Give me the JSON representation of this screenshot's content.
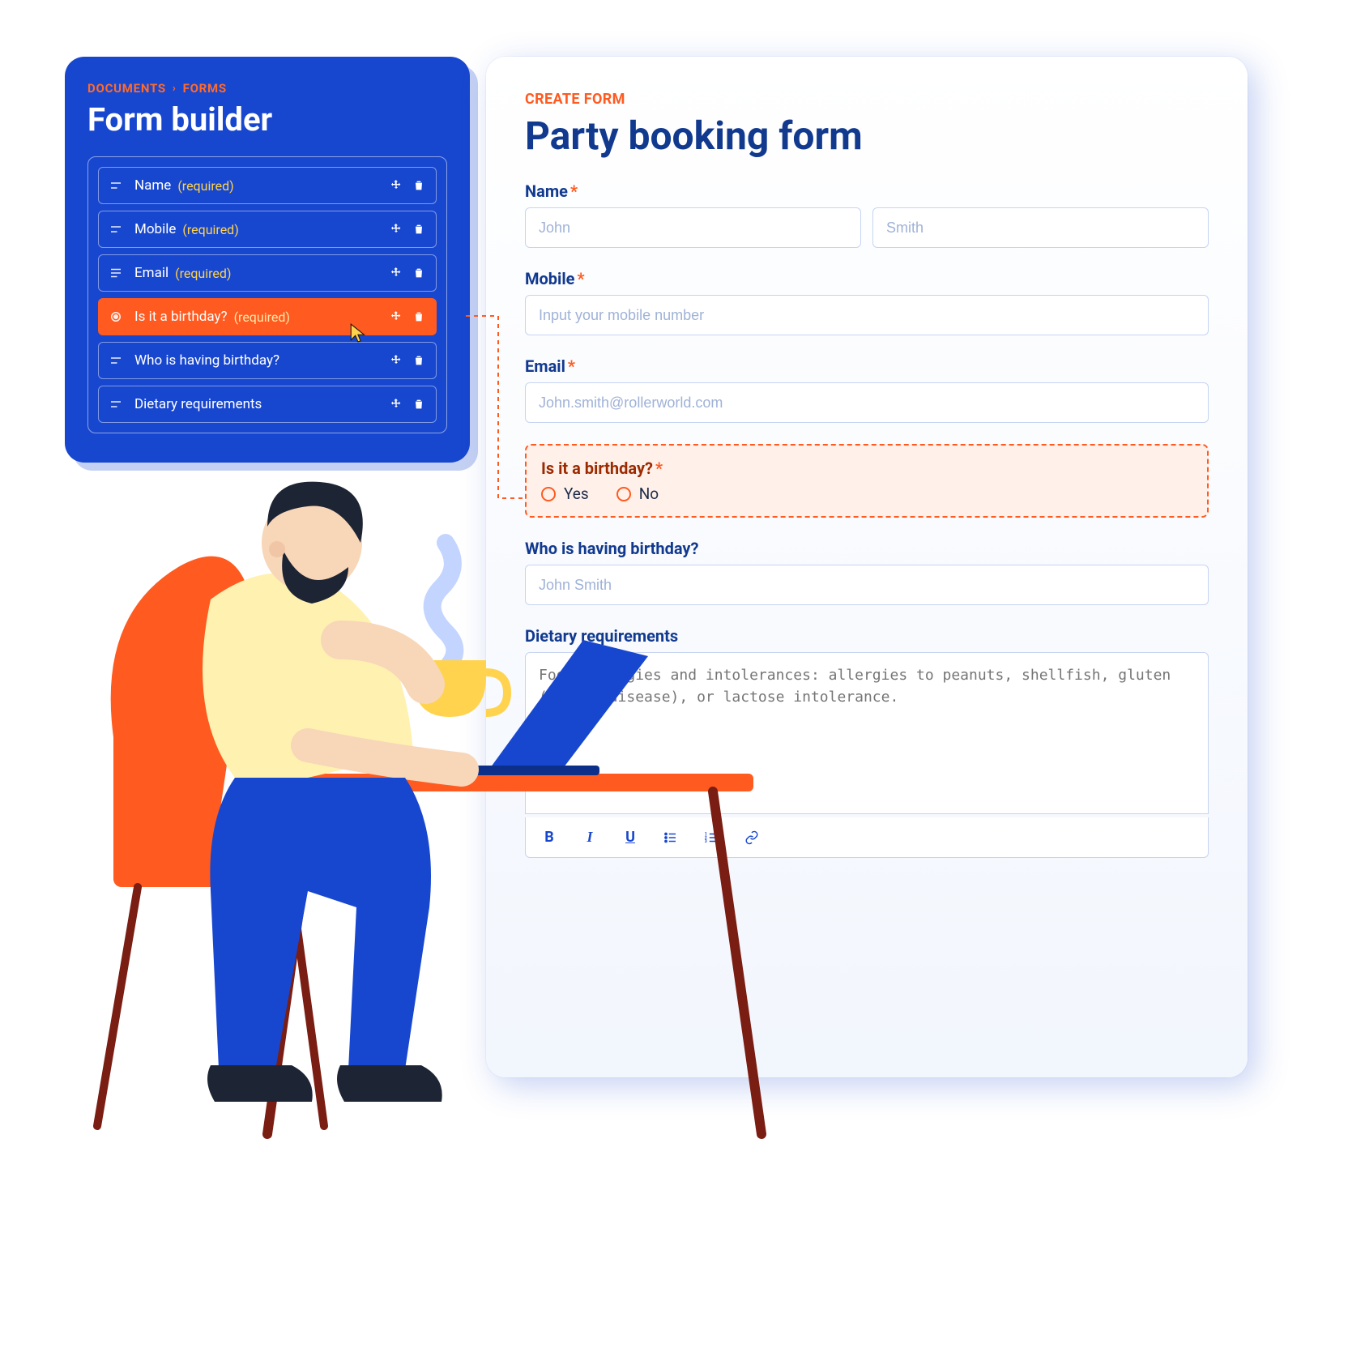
{
  "builder": {
    "breadcrumb": {
      "root": "DOCUMENTS",
      "leaf": "FORMS"
    },
    "title": "Form builder",
    "required_tag": "(required)",
    "items": [
      {
        "type": "text",
        "label": "Name",
        "required": true
      },
      {
        "type": "text",
        "label": "Mobile",
        "required": true
      },
      {
        "type": "multi",
        "label": "Email",
        "required": true
      },
      {
        "type": "radio",
        "label": "Is it a birthday?",
        "required": true,
        "active": true
      },
      {
        "type": "text",
        "label": "Who is having birthday?",
        "required": false
      },
      {
        "type": "text",
        "label": "Dietary requirements",
        "required": false
      }
    ]
  },
  "preview": {
    "eyebrow": "CREATE FORM",
    "title": "Party booking form",
    "name": {
      "label": "Name",
      "first_placeholder": "John",
      "last_placeholder": "Smith"
    },
    "mobile": {
      "label": "Mobile",
      "placeholder": "Input your mobile number"
    },
    "email": {
      "label": "Email",
      "placeholder": "John.smith@rollerworld.com"
    },
    "birthday_q": {
      "label": "Is it a birthday?",
      "options": {
        "yes": "Yes",
        "no": "No"
      }
    },
    "who": {
      "label": "Who is having birthday?",
      "placeholder": "John Smith"
    },
    "diet": {
      "label": "Dietary requirements",
      "placeholder": "Food allergies and intolerances: allergies to peanuts, shellfish, gluten (celiac disease), or lactose intolerance."
    },
    "rte": {
      "bold": "B",
      "italic": "I",
      "underline": "U"
    }
  }
}
